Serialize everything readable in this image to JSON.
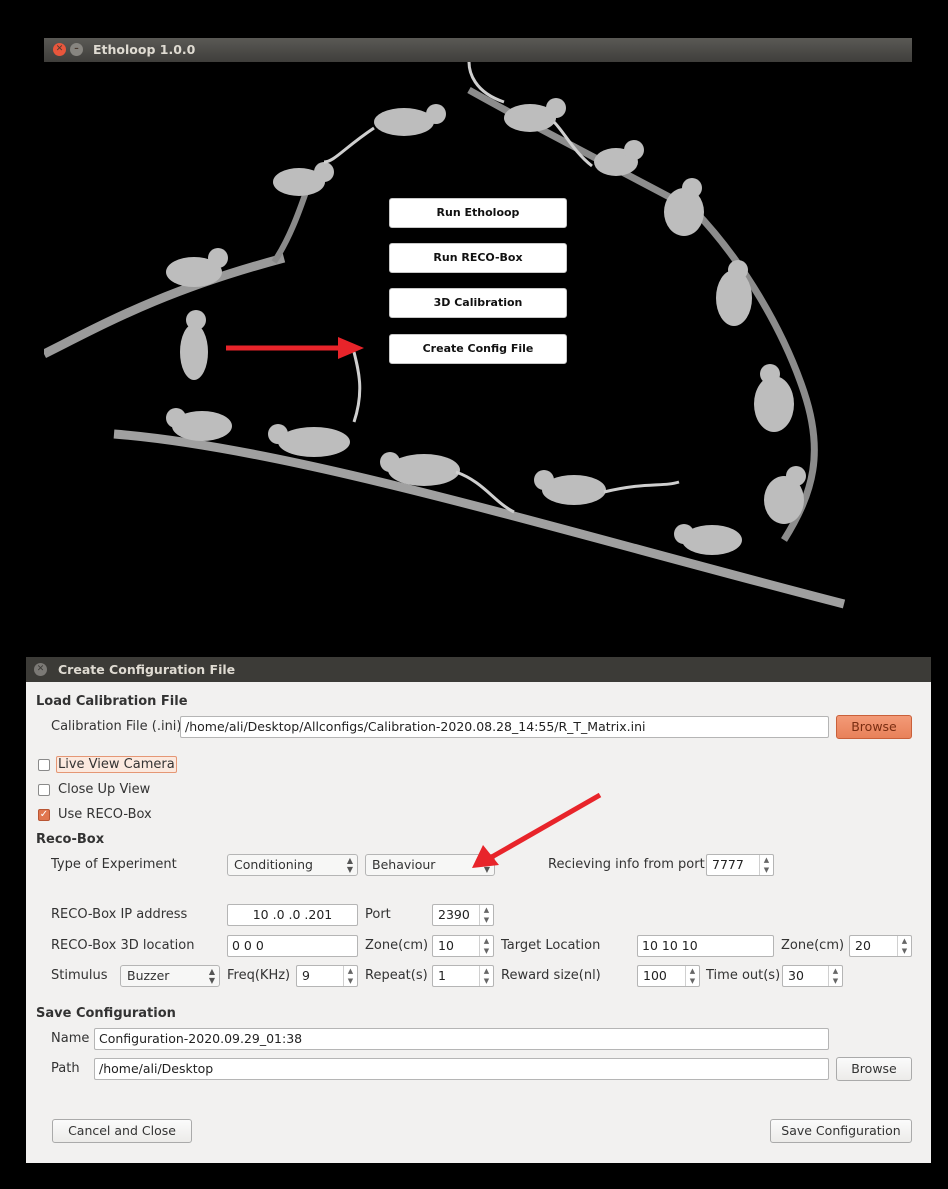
{
  "main_window": {
    "title": "Etholoop 1.0.0",
    "buttons": [
      {
        "label": "Run Etholoop"
      },
      {
        "label": "Run RECO-Box"
      },
      {
        "label": "3D Calibration"
      },
      {
        "label": "Create Config File"
      }
    ]
  },
  "dialog": {
    "title": "Create Configuration File",
    "load_section": {
      "heading": "Load Calibration File",
      "file_label": "Calibration File (.ini)",
      "file_value": "/home/ali/Desktop/Allconfigs/Calibration-2020.08.28_14:55/R_T_Matrix.ini",
      "browse_label": "Browse"
    },
    "options": {
      "live_view": {
        "label": "Live View Camera",
        "checked": false
      },
      "close_up": {
        "label": "Close Up View",
        "checked": false
      },
      "use_reco": {
        "label": "Use RECO-Box",
        "checked": true
      }
    },
    "reco_section": {
      "heading": "Reco-Box",
      "experiment_label": "Type of Experiment",
      "experiment_value": "Conditioning",
      "mode_value": "Behaviour",
      "port_info_label": "Recieving info from port",
      "port_info_value": "7777",
      "ip_label": "RECO-Box IP address",
      "ip_value": "10 .0 .0 .201",
      "port_label": "Port",
      "port_value": "2390",
      "location_label": "RECO-Box 3D location",
      "location_value": "0 0 0",
      "zone1_label": "Zone(cm)",
      "zone1_value": "10",
      "target_label": "Target Location",
      "target_value": "10 10 10",
      "zone2_label": "Zone(cm)",
      "zone2_value": "20",
      "stimulus_label": "Stimulus",
      "stimulus_value": "Buzzer",
      "freq_label": "Freq(KHz)",
      "freq_value": "9",
      "repeat_label": "Repeat(s)",
      "repeat_value": "1",
      "reward_label": "Reward size(nl)",
      "reward_value": "100",
      "timeout_label": "Time out(s)",
      "timeout_value": "30"
    },
    "save_section": {
      "heading": "Save Configuration",
      "name_label": "Name",
      "name_value": "Configuration-2020.09.29_01:38",
      "path_label": "Path",
      "path_value": "/home/ali/Desktop",
      "browse_label": "Browse"
    },
    "cancel_label": "Cancel and Close",
    "save_label": "Save Configuration"
  },
  "colors": {
    "annotation_arrow": "#e8242a",
    "accent_orange": "#e8815a",
    "titlebar": "#3c3b37"
  }
}
